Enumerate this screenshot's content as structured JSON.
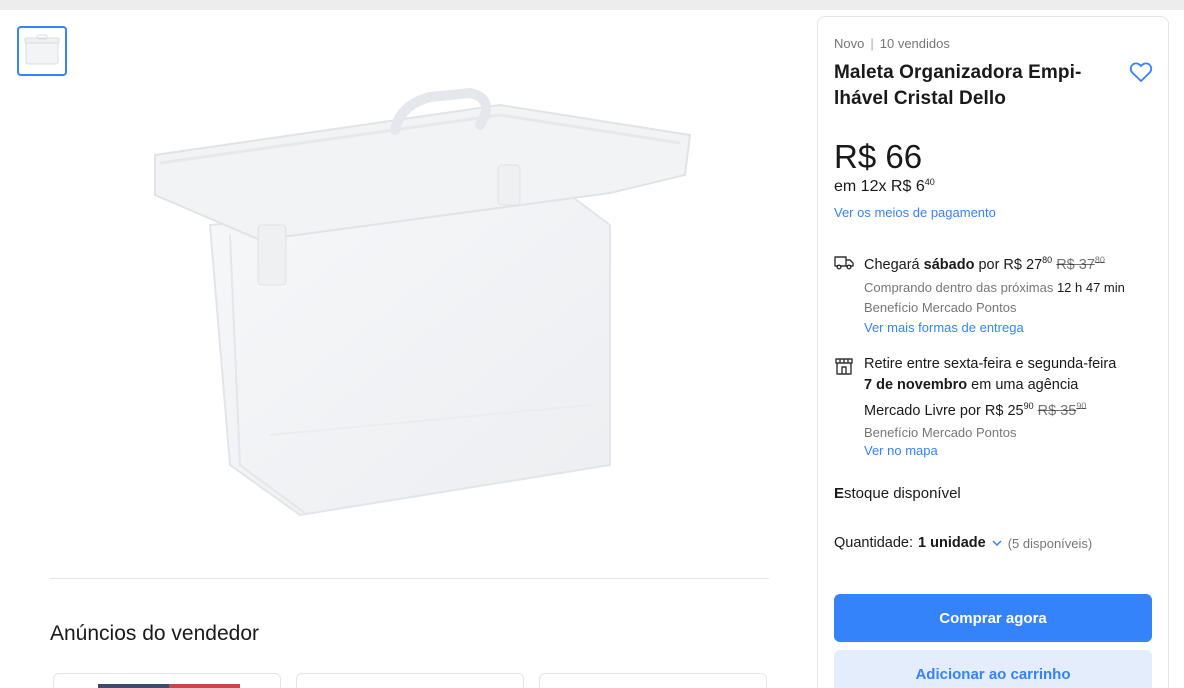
{
  "gallery": {
    "thumb_icon": "product-thumbnail",
    "main_image": "transparent-plastic-file-case"
  },
  "seller_ads": {
    "title": "Anúncios do vendedor"
  },
  "product": {
    "condition": "Novo",
    "sold": "10 vendidos",
    "title_line1": "Maleta Organizadora Empi-",
    "title_line2": "lhável Cristal Dello",
    "price": "R$ 66",
    "installments_prefix": "em 12x R$ 6",
    "installments_cents": "40",
    "payment_link": "Ver os meios de pagamento"
  },
  "shipping": {
    "prefix": "Chegará ",
    "day": "sábado",
    "by": " por R$ 27",
    "cents": "80",
    "old_price": "R$ 37",
    "old_cents": "80",
    "buy_within_prefix": "Comprando dentro das próximas ",
    "buy_within_time": "12 h 47 min",
    "benefit": "Benefício Mercado Pontos",
    "more_link": "Ver mais formas de entrega"
  },
  "pickup": {
    "prefix": "Retire ",
    "dates": "entre sexta-feira e segunda-feira",
    "date2": "7 de novembro",
    "suffix": " em uma agência",
    "line3_prefix": "Mercado Livre por R$ 25",
    "cents": "90",
    "old_price": "R$ 35",
    "old_cents": "90",
    "benefit": "Benefício Mercado Pontos",
    "map_link": "Ver no mapa"
  },
  "stock": {
    "first_letter": "E",
    "rest": "stoque disponível"
  },
  "quantity": {
    "label": "Quantidade:",
    "value": "1 unidade",
    "available": "(5 disponíveis)"
  },
  "actions": {
    "buy_now": "Comprar agora",
    "add_to_cart": "Adicionar ao carrinho"
  },
  "colors": {
    "accent": "#3483fa",
    "secondary_button_bg": "#e3edfb"
  }
}
